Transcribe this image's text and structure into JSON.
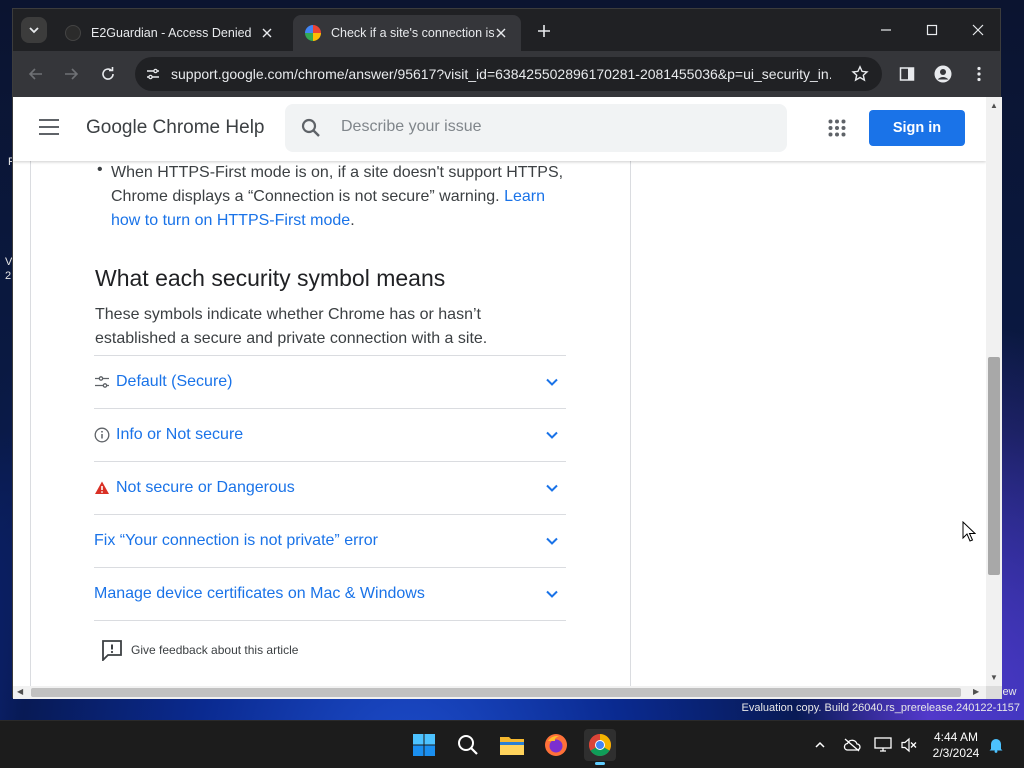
{
  "browser": {
    "tabs": [
      {
        "title": "E2Guardian - Access Denied",
        "active": false
      },
      {
        "title": "Check if a site's connection is se",
        "active": true
      }
    ],
    "url": "support.google.com/chrome/answer/95617?visit_id=638425502896170281-2081455036&p=ui_security_in..."
  },
  "help_header": {
    "title": "Google Chrome Help",
    "search_placeholder": "Describe your issue",
    "signin_label": "Sign in"
  },
  "article": {
    "bullet_text": "When HTTPS-First mode is on, if a site doesn't support HTTPS, Chrome displays a “Connection is not secure” warning.",
    "bullet_link": "Learn how to turn on HTTPS-First mode",
    "section_title": "What each security symbol means",
    "section_desc": "These symbols indicate whether Chrome has or hasn’t established a secure and private connection with a site.",
    "accordion": [
      {
        "label": "Default (Secure)",
        "icon": "tune-icon"
      },
      {
        "label": "Info or Not secure",
        "icon": "info-icon"
      },
      {
        "label": "Not secure or Dangerous",
        "icon": "warning-icon"
      },
      {
        "label": "Fix “Your connection is not private” error",
        "icon": ""
      },
      {
        "label": "Manage device certificates on Mac & Windows",
        "icon": ""
      }
    ],
    "feedback_label": "Give feedback about this article"
  },
  "desktop": {
    "eval_partial": "iew",
    "eval_text": "Evaluation copy. Build 26040.rs_prerelease.240122-1157",
    "edge_fragments": [
      "F",
      "V",
      "2"
    ]
  },
  "taskbar": {
    "time": "4:44 AM",
    "date": "2/3/2024"
  },
  "colors": {
    "link": "#1a73e8",
    "signin_bg": "#1a73e8",
    "warning": "#d93025"
  }
}
